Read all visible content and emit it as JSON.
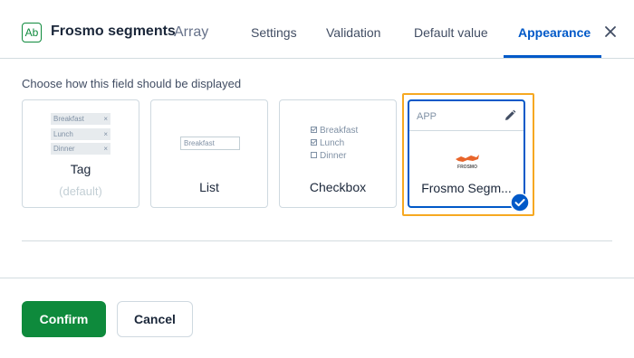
{
  "header": {
    "field_icon_text": "Ab",
    "field_title": "Frosmo segments",
    "field_type": "Array",
    "tabs": [
      {
        "label": "Settings"
      },
      {
        "label": "Validation"
      },
      {
        "label": "Default value"
      },
      {
        "label": "Appearance",
        "active": true
      }
    ]
  },
  "main": {
    "prompt": "Choose how this field should be displayed",
    "cards": {
      "tag": {
        "label": "Tag",
        "sublabel": "(default)",
        "pills": [
          "Breakfast",
          "Lunch",
          "Dinner"
        ],
        "remove_glyph": "×"
      },
      "list": {
        "label": "List",
        "input_value": "Breakfast"
      },
      "checkbox": {
        "label": "Checkbox",
        "options": [
          {
            "label": "Breakfast",
            "checked": true
          },
          {
            "label": "Lunch",
            "checked": true
          },
          {
            "label": "Dinner",
            "checked": false
          }
        ]
      },
      "app": {
        "badge": "APP",
        "name": "Frosmo Segm...",
        "logo_text": "FROSMO",
        "selected": true
      }
    }
  },
  "footer": {
    "confirm_label": "Confirm",
    "cancel_label": "Cancel"
  },
  "colors": {
    "primary": "#0059c8",
    "confirm": "#0e8a3c",
    "highlight": "#f6a821",
    "logo": "#e8652b"
  },
  "icons": [
    "field-type-icon",
    "close-icon",
    "pencil-icon",
    "selected-check-icon",
    "frosmo-logo"
  ]
}
